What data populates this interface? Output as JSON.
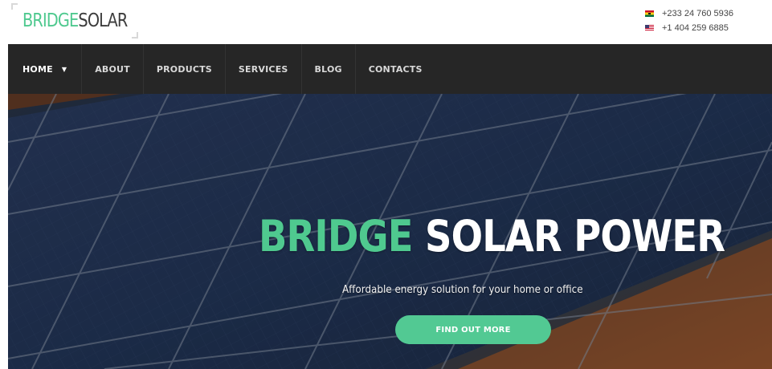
{
  "logo": {
    "part1": "BRIDGE",
    "part2": "SOLAR"
  },
  "contacts": [
    {
      "flag": "ghana-flag-icon",
      "number": "+233 24 760 5936"
    },
    {
      "flag": "usa-flag-icon",
      "number": "+1 404 259 6885"
    }
  ],
  "nav": {
    "items": [
      "HOME",
      "ABOUT",
      "PRODUCTS",
      "SERVICES",
      "BLOG",
      "CONTACTS"
    ],
    "home_dropdown_icon": "chevron-down-icon"
  },
  "hero": {
    "title_part1": "BRIDGE",
    "title_part2": "SOLAR POWER",
    "subtitle": "Affordable energy solution for your home or office",
    "cta": "FIND OUT MORE"
  },
  "colors": {
    "brand_green": "#4fc98f",
    "nav_bg": "#262626",
    "button_bg": "#52c993"
  }
}
